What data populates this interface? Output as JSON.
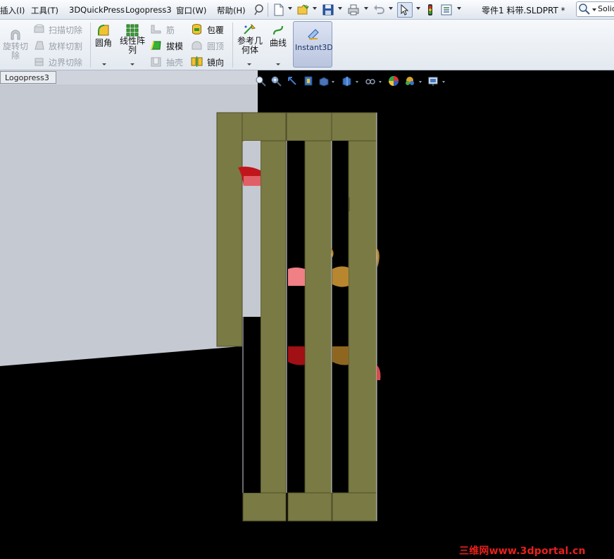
{
  "menu": [
    {
      "key": "insert",
      "label": "插入(I)"
    },
    {
      "key": "tools",
      "label": "工具(T)"
    },
    {
      "key": "quickpress",
      "label": "3DQuickPress"
    },
    {
      "key": "logopress",
      "label": "Logopress3"
    },
    {
      "key": "window",
      "label": "窗口(W)"
    },
    {
      "key": "help",
      "label": "帮助(H)"
    }
  ],
  "quick_access": [
    {
      "name": "pin-icon"
    },
    {
      "name": "new-document-icon"
    },
    {
      "name": "open-folder-icon"
    },
    {
      "name": "save-icon"
    },
    {
      "name": "print-icon"
    },
    {
      "name": "undo-icon"
    },
    {
      "name": "select-cursor-icon"
    },
    {
      "name": "rebuild-traffic-light-icon"
    },
    {
      "name": "options-list-icon"
    }
  ],
  "document_title": "零件1 料带.SLDPRT *",
  "search": {
    "label": "Solid"
  },
  "ribbon": {
    "revolve_cut": "旋转切除",
    "sweep_cut": "扫描切除",
    "loft_cut": "放样切割",
    "boundary_cut": "边界切除",
    "fillet": "圆角",
    "linear_pattern": "线性阵列",
    "rib": "筋",
    "draft": "拔模",
    "shell": "抽壳",
    "wrap": "包覆",
    "dome": "圆顶",
    "mirror": "镜向",
    "reference_geometry": "参考几何体",
    "curves": "曲线",
    "instant3d": "Instant3D"
  },
  "tabs": [
    {
      "label": "Logopress3"
    }
  ],
  "view_toolbar": [
    {
      "name": "zoom-to-fit-icon"
    },
    {
      "name": "zoom-to-area-icon"
    },
    {
      "name": "previous-view-icon"
    },
    {
      "name": "section-view-icon"
    },
    {
      "name": "view-orientation-icon"
    },
    {
      "name": "display-style-icon"
    },
    {
      "name": "hide-show-items-icon"
    },
    {
      "name": "edit-appearance-icon"
    },
    {
      "name": "apply-scene-icon"
    },
    {
      "name": "view-settings-icon"
    }
  ],
  "colors": {
    "strip": "#7a7a45",
    "strip_edge": "#4e4e28",
    "background": "#000000",
    "wall": "#c5c9d2",
    "red_tab": "#c0161b",
    "pink_tab": "#f07f86",
    "tan_tab": "#b8862e"
  },
  "watermark": "三维网www.3dportal.cn"
}
